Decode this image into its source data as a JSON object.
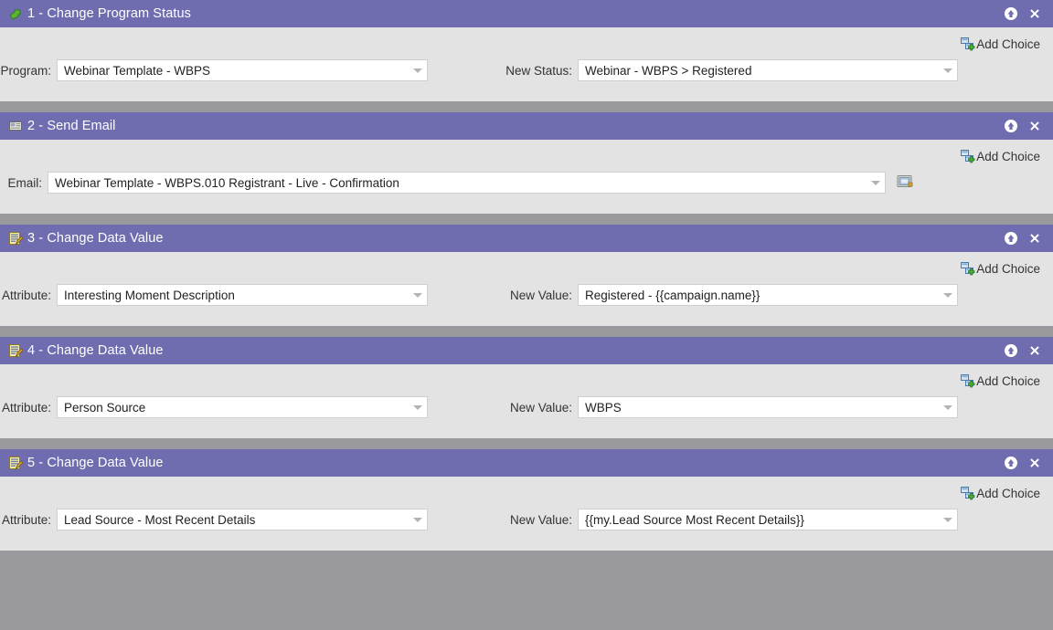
{
  "theme": {
    "header_bg": "#6f6caf",
    "panel_bg": "#e3e3e3",
    "page_bg": "#9a9a9e",
    "title_color": "#ffffff",
    "input_bg": "#ffffff",
    "input_border": "#cfcfcf"
  },
  "header_buttons": {
    "collapse_label": "collapse",
    "close_label": "close"
  },
  "steps": [
    {
      "number": "1",
      "icon": "green-arrow-icon",
      "title": "1 - Change Program Status",
      "add_choice_label": "Add Choice",
      "fields": [
        {
          "label": "Program:",
          "value": "Webinar Template - WBPS"
        },
        {
          "label": "New Status:",
          "value": "Webinar - WBPS > Registered"
        }
      ]
    },
    {
      "number": "2",
      "icon": "email-icon",
      "title": "2 - Send Email",
      "add_choice_label": "Add Choice",
      "fields": [
        {
          "label": "Email:",
          "value": "Webinar Template - WBPS.010 Registrant - Live - Confirmation"
        }
      ],
      "has_preview_button": true
    },
    {
      "number": "3",
      "icon": "edit-document-icon",
      "title": "3 - Change Data Value",
      "add_choice_label": "Add Choice",
      "fields": [
        {
          "label": "Attribute:",
          "value": "Interesting Moment Description"
        },
        {
          "label": "New Value:",
          "value": "Registered - {{campaign.name}}"
        }
      ]
    },
    {
      "number": "4",
      "icon": "edit-document-icon",
      "title": "4 - Change Data Value",
      "add_choice_label": "Add Choice",
      "fields": [
        {
          "label": "Attribute:",
          "value": "Person Source"
        },
        {
          "label": "New Value:",
          "value": "WBPS"
        }
      ]
    },
    {
      "number": "5",
      "icon": "edit-document-icon",
      "title": "5 - Change Data Value",
      "add_choice_label": "Add Choice",
      "fields": [
        {
          "label": "Attribute:",
          "value": "Lead Source - Most Recent Details"
        },
        {
          "label": "New Value:",
          "value": "{{my.Lead Source Most Recent Details}}"
        }
      ]
    }
  ]
}
